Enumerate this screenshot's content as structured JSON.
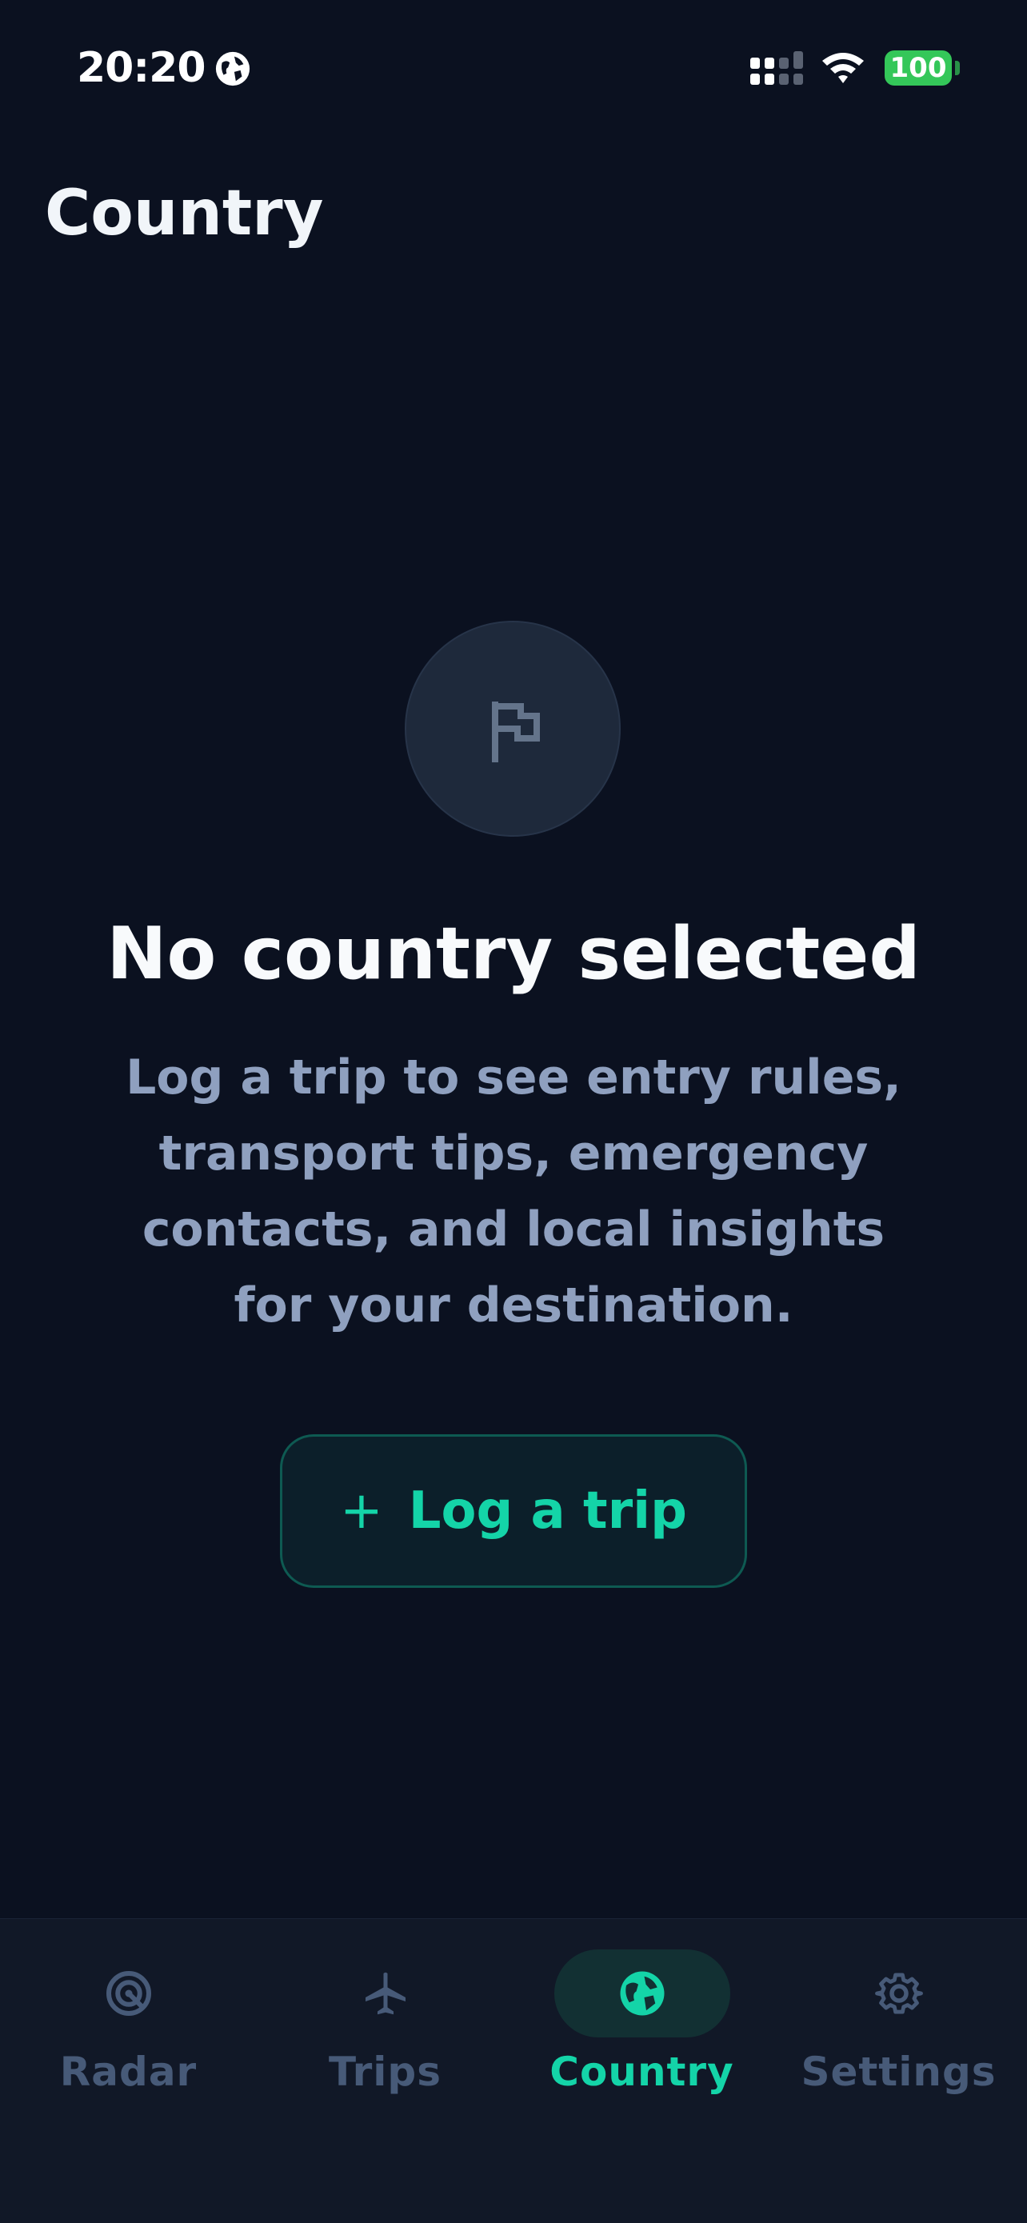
{
  "status_bar": {
    "time": "20:20",
    "battery": "100"
  },
  "header": {
    "title": "Country"
  },
  "empty_state": {
    "icon": "flag-icon",
    "title": "No country selected",
    "description": "Log a trip to see entry rules, transport tips, emergency contacts, and local insights for your destination.",
    "button_label": "Log a trip",
    "button_icon": "plus-icon"
  },
  "tab_bar": {
    "tabs": [
      {
        "label": "Radar",
        "icon": "radar-icon",
        "active": false
      },
      {
        "label": "Trips",
        "icon": "airplane-icon",
        "active": false
      },
      {
        "label": "Country",
        "icon": "globe-icon",
        "active": true
      },
      {
        "label": "Settings",
        "icon": "gear-icon",
        "active": false
      }
    ]
  },
  "colors": {
    "background": "#0b1120",
    "accent": "#14d4a8",
    "muted_text": "#8fa0bf",
    "inactive_tab": "#475a78",
    "battery": "#34c759"
  }
}
